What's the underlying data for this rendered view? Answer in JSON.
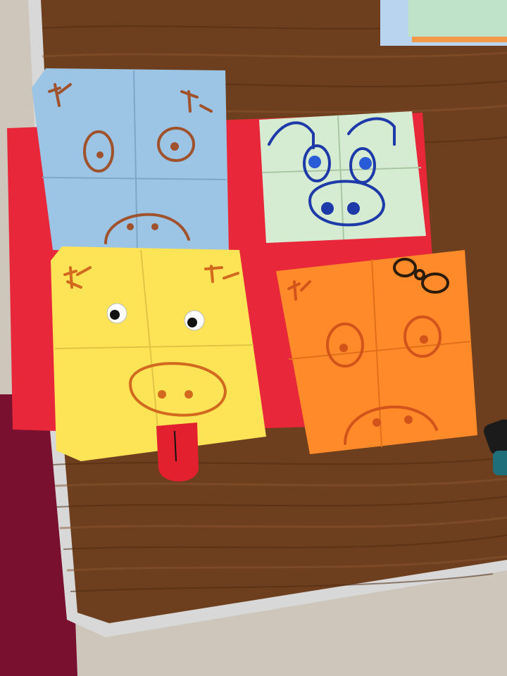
{
  "scene": {
    "description_labels": {},
    "colors": {
      "floor": "#cfc6bb",
      "table_wood": "#6b3f1f",
      "table_edge": "#c8c8c8",
      "red_paper": "#e8283a",
      "maroon_folder": "#7a1030",
      "blue_pig": "#9cc4e4",
      "mint_pig": "#d6ecd2",
      "yellow_pig": "#fde457",
      "orange_pig": "#ff8a2a",
      "brown_ink": "#a0522d",
      "blue_ink": "#1d3aa8",
      "orange_ink": "#d2541a",
      "tongue": "#e3202e",
      "sticky_notes": "#a9d6c9"
    },
    "objects": [
      "wooden-table",
      "red-paper-sheet",
      "blue-origami-pig",
      "mint-origami-pig",
      "yellow-origami-pig",
      "orange-origami-pig",
      "sticky-note-stack",
      "marker-pens",
      "maroon-folder"
    ]
  }
}
